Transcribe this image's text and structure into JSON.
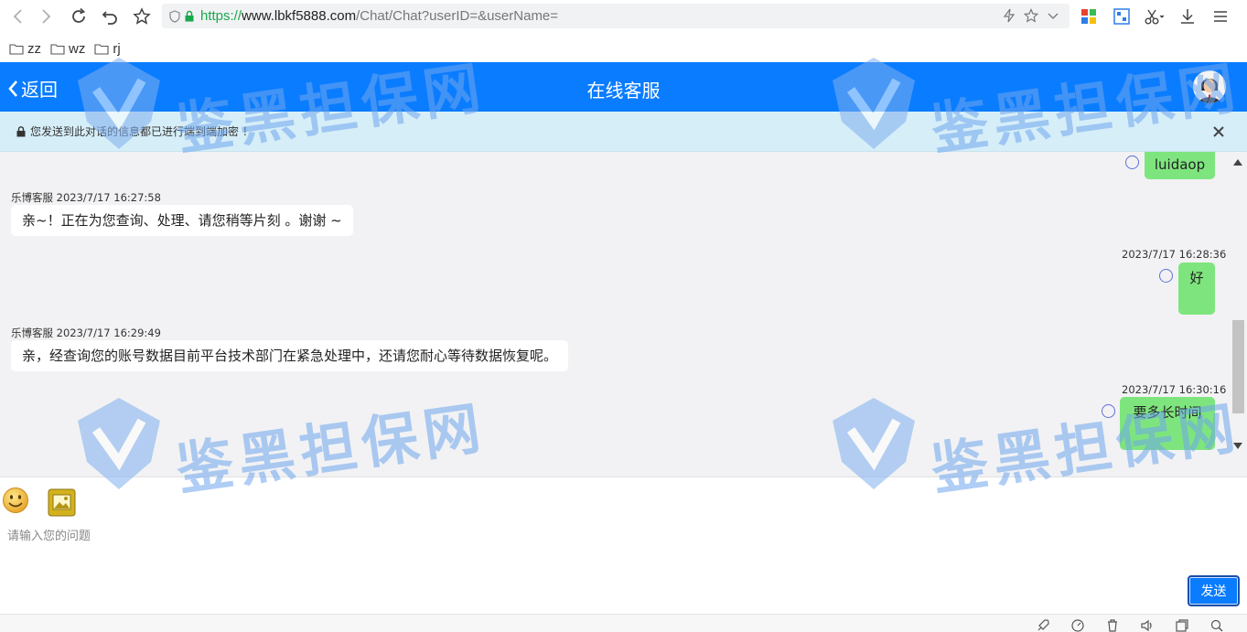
{
  "browser": {
    "url_scheme": "https://",
    "url_host": "www.lbkf5888.com",
    "url_path": "/Chat/Chat?userID=&userName="
  },
  "bookmarks": [
    {
      "label": "zz"
    },
    {
      "label": "wz"
    },
    {
      "label": "rj"
    }
  ],
  "header": {
    "back_label": "返回",
    "title": "在线客服"
  },
  "notice": {
    "text": "您发送到此对话的信息都已进行端到端加密 ！"
  },
  "messages": [
    {
      "side": "right",
      "text": "luidaop"
    },
    {
      "side": "left",
      "sender": "乐博客服",
      "time": "2023/7/17 16:27:58",
      "text": "亲~！正在为您查询、处理、请您稍等片刻 。谢谢 ~"
    },
    {
      "side": "right",
      "time": "2023/7/17 16:28:36",
      "text": "好"
    },
    {
      "side": "left",
      "sender": "乐博客服",
      "time": "2023/7/17 16:29:49",
      "text": "亲，经查询您的账号数据目前平台技术部门在紧急处理中，还请您耐心等待数据恢复呢。"
    },
    {
      "side": "right",
      "time": "2023/7/17 16:30:16",
      "text": "要多长时间"
    }
  ],
  "input": {
    "placeholder": "请输入您的问题",
    "send_label": "发送"
  },
  "watermark": {
    "text": "鉴黑担保网"
  },
  "colors": {
    "header": "#0a7cff",
    "bubble_right": "#7ee57e",
    "notice_bg": "#d6eef8"
  }
}
